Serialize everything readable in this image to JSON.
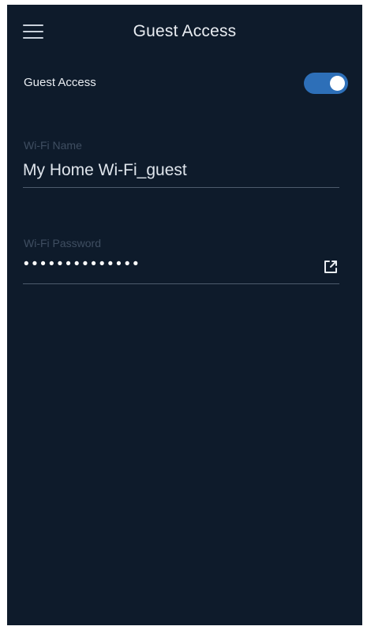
{
  "header": {
    "title": "Guest Access"
  },
  "guest_access": {
    "label": "Guest Access",
    "enabled": true
  },
  "wifi_name": {
    "label": "Wi-Fi Name",
    "value": "My Home Wi-Fi_guest"
  },
  "wifi_password": {
    "label": "Wi-Fi Password",
    "masked_value": "••••••••••••••"
  },
  "colors": {
    "background": "#0e1b2b",
    "toggle_on": "#2d6fb8",
    "text": "#e9edf2",
    "label_muted": "#3f4e61"
  },
  "icons": {
    "menu": "hamburger-menu-icon",
    "share": "share-icon"
  }
}
